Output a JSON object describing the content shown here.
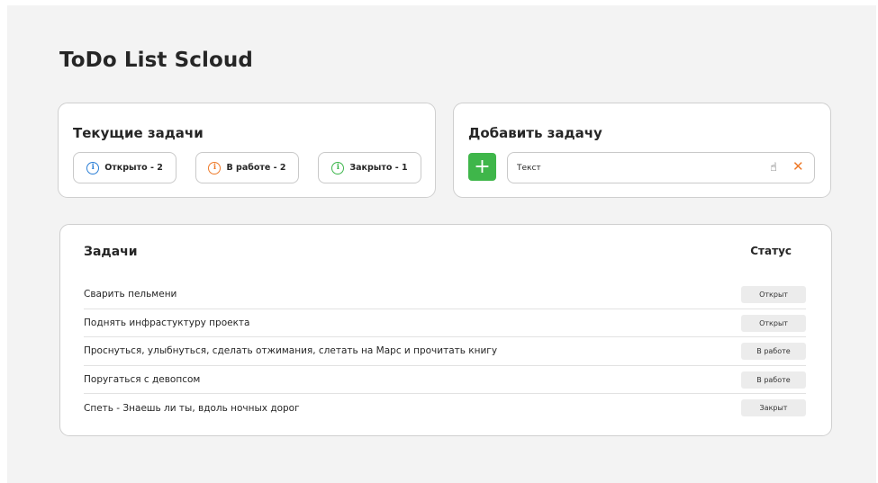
{
  "app": {
    "title": "ToDo List Scloud"
  },
  "current": {
    "title": "Текущие задачи",
    "chips": [
      {
        "label": "Открыто - 2",
        "icon": "info-icon",
        "color": "#2b7fd6"
      },
      {
        "label": "В работе - 2",
        "icon": "info-icon",
        "color": "#ee7a2a"
      },
      {
        "label": "Закрыто - 1",
        "icon": "info-icon",
        "color": "#3bb54a"
      }
    ]
  },
  "add": {
    "title": "Добавить задачу",
    "add_button": "+",
    "input_value": "Текст",
    "clear_icon": "close-icon",
    "accent": "#3fb64a"
  },
  "tasks": {
    "title": "Задачи",
    "status_header": "Статус",
    "rows": [
      {
        "text": "Сварить пельмени",
        "status": "Открыт"
      },
      {
        "text": "Поднять инфрастуктуру проекта",
        "status": "Открыт"
      },
      {
        "text": "Проснуться, улыбнуться, сделать отжимания, слетать на Марс и прочитать книгу",
        "status": "В работе"
      },
      {
        "text": "Поругаться с девопсом",
        "status": "В работе"
      },
      {
        "text": "Спеть - Знаешь ли ты, вдоль ночных дорог",
        "status": "Закрыт"
      }
    ]
  }
}
